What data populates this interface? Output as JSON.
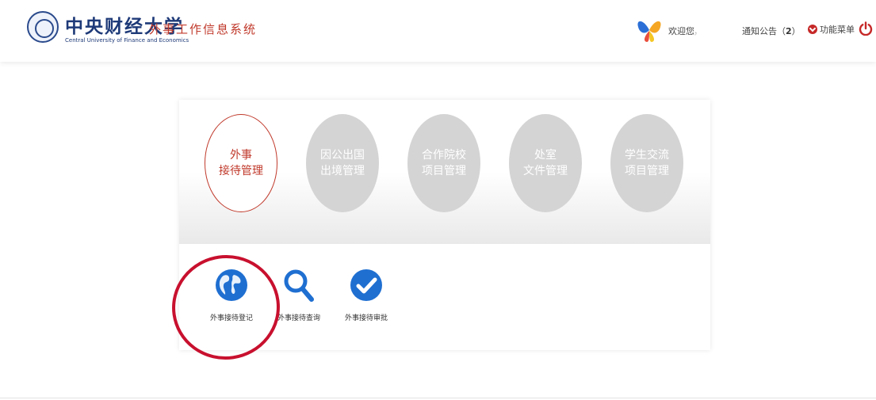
{
  "header": {
    "university_name": "中央财经大学",
    "university_name_en": "Central University of Finance and Economics",
    "system_title": "外事工作信息系统",
    "welcome": "欢迎您",
    "username": "，",
    "notice_label": "通知公告（",
    "notice_count": "2",
    "notice_close": "）",
    "function_menu": "功能菜单",
    "colors": {
      "accent": "#c0392b",
      "brand_blue": "#1e3a78"
    }
  },
  "tabs": [
    {
      "line1": "外事",
      "line2": "接待管理",
      "active": true
    },
    {
      "line1": "因公出国",
      "line2": "出境管理",
      "active": false
    },
    {
      "line1": "合作院校",
      "line2": "项目管理",
      "active": false
    },
    {
      "line1": "处室",
      "line2": "文件管理",
      "active": false
    },
    {
      "line1": "学生交流",
      "line2": "项目管理",
      "active": false
    }
  ],
  "subitems": [
    {
      "icon": "globe-icon",
      "label": "外事接待登记"
    },
    {
      "icon": "search-icon",
      "label": "外事接待查询"
    },
    {
      "icon": "check-circle-icon",
      "label": "外事接待审批"
    }
  ]
}
